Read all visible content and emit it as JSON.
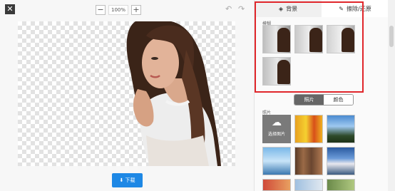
{
  "toolbar": {
    "close_icon": "close-icon",
    "zoom_out_label": "−",
    "zoom_value": "100%",
    "zoom_in_label": "+",
    "undo_icon": "undo-icon",
    "redo_icon": "redo-icon"
  },
  "download": {
    "label": "下载"
  },
  "tabs": [
    {
      "label": "背景",
      "icon": "layers-icon"
    },
    {
      "label": "擦除/还原",
      "icon": "eraser-icon"
    }
  ],
  "sections": {
    "blur_label": "模糊",
    "photo_label": "照片",
    "upload_label": "选择图片"
  },
  "segment": {
    "photo": "照片",
    "color": "颜色"
  },
  "colors": {
    "accent": "#1e88e5",
    "highlight": "#e0262b"
  }
}
